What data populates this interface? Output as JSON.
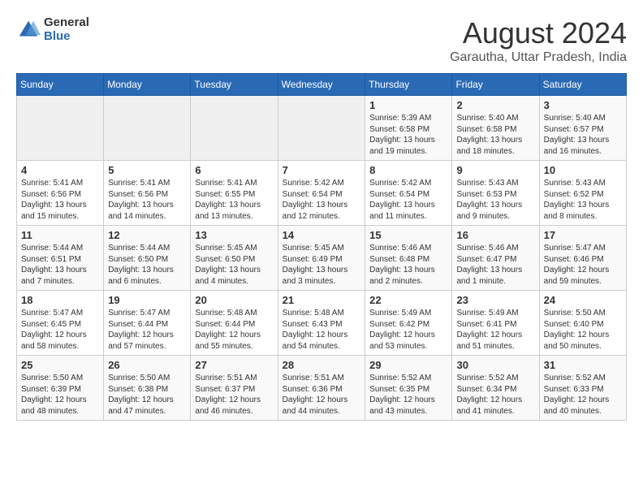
{
  "logo": {
    "general": "General",
    "blue": "Blue"
  },
  "title": "August 2024",
  "location": "Garautha, Uttar Pradesh, India",
  "weekdays": [
    "Sunday",
    "Monday",
    "Tuesday",
    "Wednesday",
    "Thursday",
    "Friday",
    "Saturday"
  ],
  "weeks": [
    [
      {
        "day": "",
        "info": ""
      },
      {
        "day": "",
        "info": ""
      },
      {
        "day": "",
        "info": ""
      },
      {
        "day": "",
        "info": ""
      },
      {
        "day": "1",
        "info": "Sunrise: 5:39 AM\nSunset: 6:58 PM\nDaylight: 13 hours\nand 19 minutes."
      },
      {
        "day": "2",
        "info": "Sunrise: 5:40 AM\nSunset: 6:58 PM\nDaylight: 13 hours\nand 18 minutes."
      },
      {
        "day": "3",
        "info": "Sunrise: 5:40 AM\nSunset: 6:57 PM\nDaylight: 13 hours\nand 16 minutes."
      }
    ],
    [
      {
        "day": "4",
        "info": "Sunrise: 5:41 AM\nSunset: 6:56 PM\nDaylight: 13 hours\nand 15 minutes."
      },
      {
        "day": "5",
        "info": "Sunrise: 5:41 AM\nSunset: 6:56 PM\nDaylight: 13 hours\nand 14 minutes."
      },
      {
        "day": "6",
        "info": "Sunrise: 5:41 AM\nSunset: 6:55 PM\nDaylight: 13 hours\nand 13 minutes."
      },
      {
        "day": "7",
        "info": "Sunrise: 5:42 AM\nSunset: 6:54 PM\nDaylight: 13 hours\nand 12 minutes."
      },
      {
        "day": "8",
        "info": "Sunrise: 5:42 AM\nSunset: 6:54 PM\nDaylight: 13 hours\nand 11 minutes."
      },
      {
        "day": "9",
        "info": "Sunrise: 5:43 AM\nSunset: 6:53 PM\nDaylight: 13 hours\nand 9 minutes."
      },
      {
        "day": "10",
        "info": "Sunrise: 5:43 AM\nSunset: 6:52 PM\nDaylight: 13 hours\nand 8 minutes."
      }
    ],
    [
      {
        "day": "11",
        "info": "Sunrise: 5:44 AM\nSunset: 6:51 PM\nDaylight: 13 hours\nand 7 minutes."
      },
      {
        "day": "12",
        "info": "Sunrise: 5:44 AM\nSunset: 6:50 PM\nDaylight: 13 hours\nand 6 minutes."
      },
      {
        "day": "13",
        "info": "Sunrise: 5:45 AM\nSunset: 6:50 PM\nDaylight: 13 hours\nand 4 minutes."
      },
      {
        "day": "14",
        "info": "Sunrise: 5:45 AM\nSunset: 6:49 PM\nDaylight: 13 hours\nand 3 minutes."
      },
      {
        "day": "15",
        "info": "Sunrise: 5:46 AM\nSunset: 6:48 PM\nDaylight: 13 hours\nand 2 minutes."
      },
      {
        "day": "16",
        "info": "Sunrise: 5:46 AM\nSunset: 6:47 PM\nDaylight: 13 hours\nand 1 minute."
      },
      {
        "day": "17",
        "info": "Sunrise: 5:47 AM\nSunset: 6:46 PM\nDaylight: 12 hours\nand 59 minutes."
      }
    ],
    [
      {
        "day": "18",
        "info": "Sunrise: 5:47 AM\nSunset: 6:45 PM\nDaylight: 12 hours\nand 58 minutes."
      },
      {
        "day": "19",
        "info": "Sunrise: 5:47 AM\nSunset: 6:44 PM\nDaylight: 12 hours\nand 57 minutes."
      },
      {
        "day": "20",
        "info": "Sunrise: 5:48 AM\nSunset: 6:44 PM\nDaylight: 12 hours\nand 55 minutes."
      },
      {
        "day": "21",
        "info": "Sunrise: 5:48 AM\nSunset: 6:43 PM\nDaylight: 12 hours\nand 54 minutes."
      },
      {
        "day": "22",
        "info": "Sunrise: 5:49 AM\nSunset: 6:42 PM\nDaylight: 12 hours\nand 53 minutes."
      },
      {
        "day": "23",
        "info": "Sunrise: 5:49 AM\nSunset: 6:41 PM\nDaylight: 12 hours\nand 51 minutes."
      },
      {
        "day": "24",
        "info": "Sunrise: 5:50 AM\nSunset: 6:40 PM\nDaylight: 12 hours\nand 50 minutes."
      }
    ],
    [
      {
        "day": "25",
        "info": "Sunrise: 5:50 AM\nSunset: 6:39 PM\nDaylight: 12 hours\nand 48 minutes."
      },
      {
        "day": "26",
        "info": "Sunrise: 5:50 AM\nSunset: 6:38 PM\nDaylight: 12 hours\nand 47 minutes."
      },
      {
        "day": "27",
        "info": "Sunrise: 5:51 AM\nSunset: 6:37 PM\nDaylight: 12 hours\nand 46 minutes."
      },
      {
        "day": "28",
        "info": "Sunrise: 5:51 AM\nSunset: 6:36 PM\nDaylight: 12 hours\nand 44 minutes."
      },
      {
        "day": "29",
        "info": "Sunrise: 5:52 AM\nSunset: 6:35 PM\nDaylight: 12 hours\nand 43 minutes."
      },
      {
        "day": "30",
        "info": "Sunrise: 5:52 AM\nSunset: 6:34 PM\nDaylight: 12 hours\nand 41 minutes."
      },
      {
        "day": "31",
        "info": "Sunrise: 5:52 AM\nSunset: 6:33 PM\nDaylight: 12 hours\nand 40 minutes."
      }
    ]
  ]
}
